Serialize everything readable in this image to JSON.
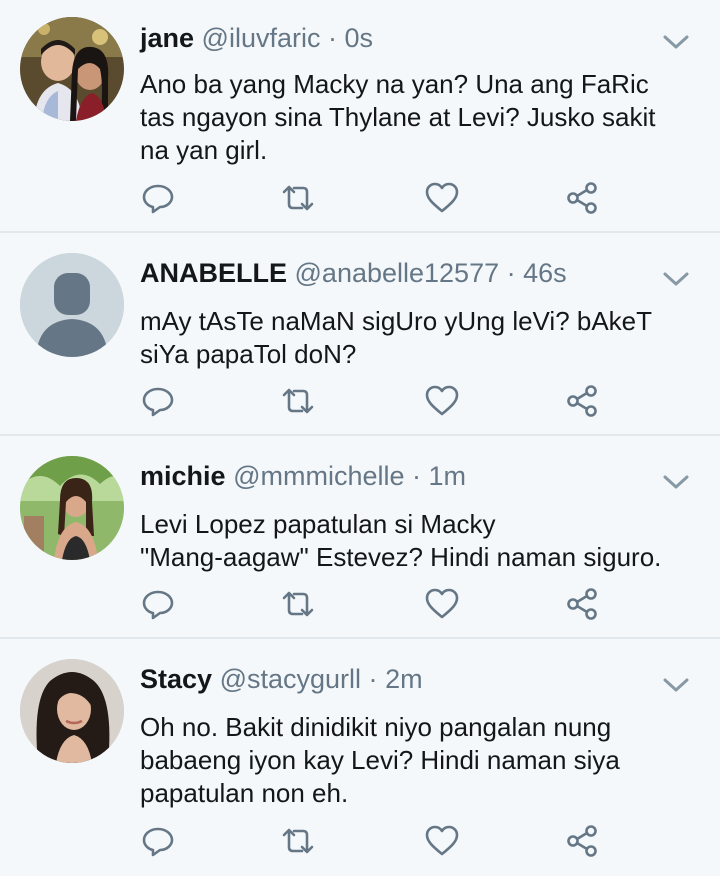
{
  "tweets": [
    {
      "name": "jane",
      "handle": "@iluvfaric",
      "separator": "·",
      "time": "0s",
      "text": "Ano ba yang Macky na yan? Una ang FaRic\ntas ngayon sina Thylane at Levi? Jusko sakit\nna yan girl.",
      "avatar": "photo-couple"
    },
    {
      "name": "ANABELLE",
      "handle": "@anabelle12577",
      "separator": "·",
      "time": "46s",
      "text": "mAy tAsTe naMaN sigUro yUng leVi? bAkeT\nsiYa papaTol doN?",
      "avatar": "default-profile"
    },
    {
      "name": "michie",
      "handle": "@mmmichelle",
      "separator": "·",
      "time": "1m",
      "text": "Levi Lopez papatulan si Macky\n\"Mang-aagaw\" Estevez? Hindi naman siguro.",
      "avatar": "photo-woman-outdoors"
    },
    {
      "name": "Stacy",
      "handle": "@stacygurll",
      "separator": "·",
      "time": "2m",
      "text": "Oh no. Bakit dinidikit niyo pangalan nung\nbabaeng iyon kay Levi? Hindi naman siya\npapatulan non eh.",
      "avatar": "photo-woman-portrait"
    }
  ],
  "icons": {
    "reply": "reply-icon",
    "retweet": "retweet-icon",
    "like": "heart-icon",
    "share": "share-icon",
    "menu": "chevron-down-icon"
  },
  "colors": {
    "background": "#f5f8fa",
    "divider": "#e1e8ed",
    "text": "#14171a",
    "secondary": "#657786"
  }
}
